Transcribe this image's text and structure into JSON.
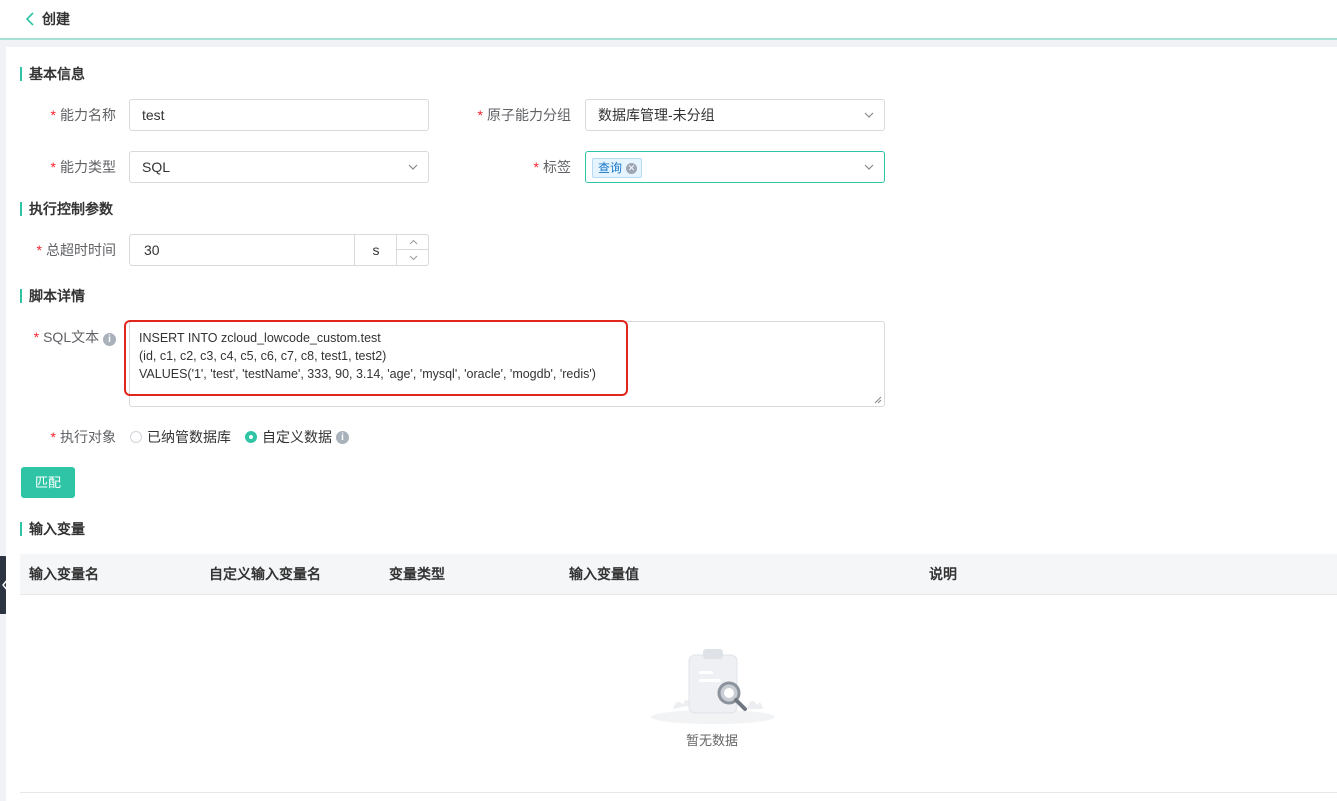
{
  "header": {
    "back_label": "创建"
  },
  "sections": {
    "basic": "基本信息",
    "exec_params": "执行控制参数",
    "script": "脚本详情",
    "input_vars": "输入变量"
  },
  "form": {
    "name_label": "能力名称",
    "name_value": "test",
    "group_label": "原子能力分组",
    "group_value": "数据库管理-未分组",
    "type_label": "能力类型",
    "type_value": "SQL",
    "tag_label": "标签",
    "tags": [
      "查询"
    ],
    "timeout_label": "总超时时间",
    "timeout_value": "30",
    "timeout_unit": "s",
    "sql_label": "SQL文本",
    "sql_lines": [
      "INSERT INTO zcloud_lowcode_custom.test",
      "(id, c1, c2, c3, c4, c5, c6, c7, c8, test1, test2)",
      "VALUES('1', 'test', 'testName', 333, 90, 3.14, 'age', 'mysql', 'oracle', 'mogdb', 'redis')"
    ],
    "target_label": "执行对象",
    "target_options": [
      "已纳管数据库",
      "自定义数据"
    ],
    "target_selected": "自定义数据",
    "match_button": "匹配"
  },
  "table": {
    "columns": [
      "输入变量名",
      "自定义输入变量名",
      "变量类型",
      "输入变量值",
      "说明"
    ],
    "empty_text": "暂无数据"
  },
  "colors": {
    "accent": "#2ec4a5",
    "required": "#f5222d",
    "highlight": "#e0261b"
  },
  "icons": [
    "chevron-left-icon",
    "chevron-down-icon",
    "close-icon",
    "info-icon",
    "empty-clipboard-icon"
  ]
}
